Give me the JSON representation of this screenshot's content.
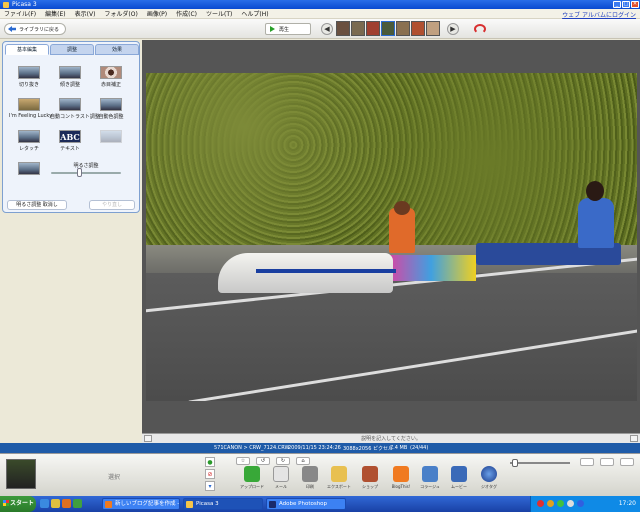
{
  "window": {
    "title": "Picasa 3"
  },
  "menu": {
    "items": [
      "ファイル(F)",
      "編集(E)",
      "表示(V)",
      "フォルダ(O)",
      "画像(P)",
      "作成(C)",
      "ツール(T)",
      "ヘルプ(H)"
    ],
    "right_link": "ウェブ アルバムにログイン"
  },
  "toolbar": {
    "back_label": "ライブラリに戻る",
    "play_label": "再生"
  },
  "edit_panel": {
    "tabs": [
      "基本編集",
      "調整",
      "効果"
    ],
    "tools": [
      {
        "label": "切り抜き",
        "enabled": true
      },
      {
        "label": "傾き調整",
        "enabled": true
      },
      {
        "label": "赤目補正",
        "enabled": true
      },
      {
        "label": "I'm Feeling Lucky",
        "enabled": true
      },
      {
        "label": "自動コントラスト調整",
        "enabled": true
      },
      {
        "label": "自動色調整",
        "enabled": true
      },
      {
        "label": "レタッチ",
        "enabled": true
      },
      {
        "label": "テキスト",
        "enabled": true
      },
      {
        "label": "",
        "enabled": false
      },
      {
        "label": "",
        "enabled": true
      }
    ],
    "slider_label": "明るさ調整",
    "undo_label": "明るさ調整 取消し",
    "redo_label": "やり直し"
  },
  "caption": {
    "placeholder": "説明を記入してください。"
  },
  "info_bar": {
    "file": "571CANON > CRW_7124.CRW",
    "date": "2009/11/15 23:24:26",
    "pixels": "3088x2056 ピクセル",
    "size": "7.4 MB",
    "count": "(24/44)"
  },
  "tray": {
    "selection_label": "選択",
    "actions": [
      "アップロード",
      "メール",
      "印刷",
      "エクスポート",
      "ショップ",
      "BlogThis!",
      "コラージュ",
      "ムービー",
      "ジオタグ"
    ]
  },
  "taskbar": {
    "start_label": "スタート",
    "tasks": [
      "新しいブログ記事を作成 -",
      "Picasa 3",
      "Adobe Photoshop"
    ],
    "clock": "17:20"
  },
  "colors": {
    "accent": "#2a6ad0",
    "info_bar": "#1f5ba8",
    "taskbar": "#245edb"
  }
}
